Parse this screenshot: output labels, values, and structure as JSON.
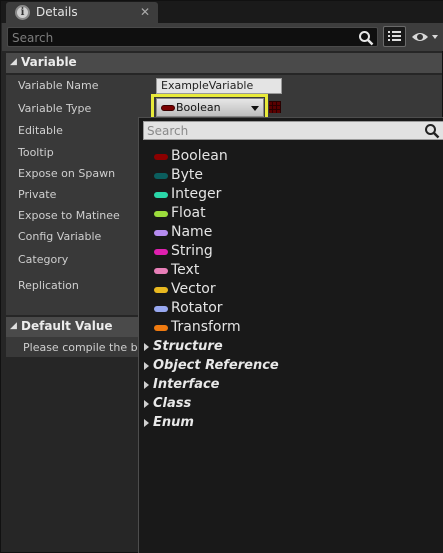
{
  "tab": {
    "title": "Details",
    "close": "✕"
  },
  "toolbar": {
    "search_placeholder": "Search"
  },
  "variable_section": {
    "title": "Variable",
    "labels": [
      "Variable Name",
      "Variable Type",
      "Editable",
      "Tooltip",
      "Expose on Spawn",
      "Private",
      "Expose to Matinee",
      "Config Variable",
      "Category",
      "Replication"
    ],
    "variable_name_value": "ExampleVariable",
    "variable_type_value": "Boolean"
  },
  "default_section": {
    "title": "Default Value",
    "message": "Please compile the blu"
  },
  "popup": {
    "search_placeholder": "Search",
    "types": [
      {
        "label": "Boolean",
        "color": "#8b0000"
      },
      {
        "label": "Byte",
        "color": "#0b5e5e"
      },
      {
        "label": "Integer",
        "color": "#2ad6a8"
      },
      {
        "label": "Float",
        "color": "#9cdc3c"
      },
      {
        "label": "Name",
        "color": "#b68cf0"
      },
      {
        "label": "String",
        "color": "#e020b0"
      },
      {
        "label": "Text",
        "color": "#e87fb8"
      },
      {
        "label": "Vector",
        "color": "#e8b820"
      },
      {
        "label": "Rotator",
        "color": "#98a8f0"
      },
      {
        "label": "Transform",
        "color": "#ef7a10"
      }
    ],
    "categories": [
      "Structure",
      "Object Reference",
      "Interface",
      "Class",
      "Enum"
    ]
  },
  "colors": {
    "highlight": "#e8ea3a",
    "panel": "#393939",
    "header": "#4a4a4a"
  }
}
